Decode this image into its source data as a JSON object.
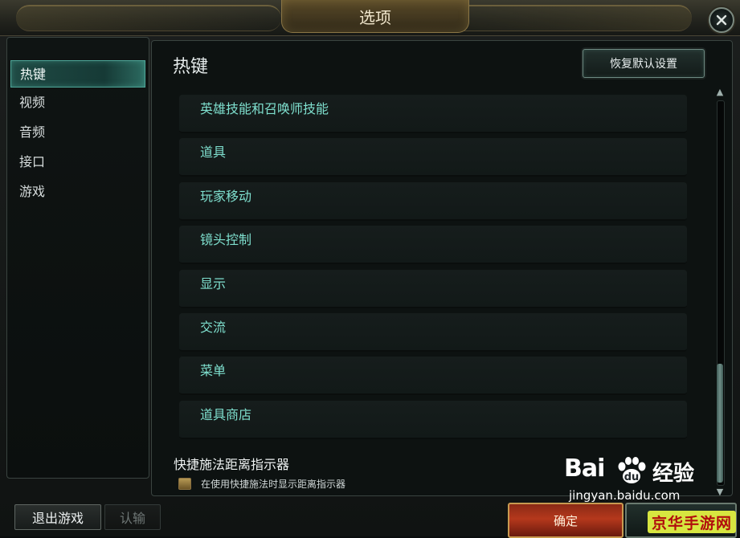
{
  "window": {
    "title": "选项"
  },
  "sidebar": {
    "items": [
      {
        "label": "热键",
        "active": true
      },
      {
        "label": "视频",
        "active": false
      },
      {
        "label": "音频",
        "active": false
      },
      {
        "label": "接口",
        "active": false
      },
      {
        "label": "游戏",
        "active": false
      }
    ]
  },
  "main": {
    "title": "热键",
    "reset_label": "恢复默认设置",
    "categories": [
      "英雄技能和召唤师技能",
      "道具",
      "玩家移动",
      "镜头控制",
      "显示",
      "交流",
      "菜单",
      "道具商店"
    ],
    "quickcast": {
      "title": "快捷施法距离指示器",
      "checkbox_label": "在使用快捷施法时显示距离指示器",
      "checked": false
    }
  },
  "footer": {
    "quit_label": "退出游戏",
    "surrender_label": "认输",
    "ok_label": "确定"
  },
  "watermark": {
    "logo_text": "Bai",
    "logo_cn": "经验",
    "url": "jingyan.baidu.com",
    "badge": "京华手游网"
  },
  "colors": {
    "accent": "#4ea698",
    "category_text": "#7fe0cf",
    "ok_button": "#b5381c",
    "badge_bg": "#d7e640",
    "badge_text": "#b10d0d"
  }
}
